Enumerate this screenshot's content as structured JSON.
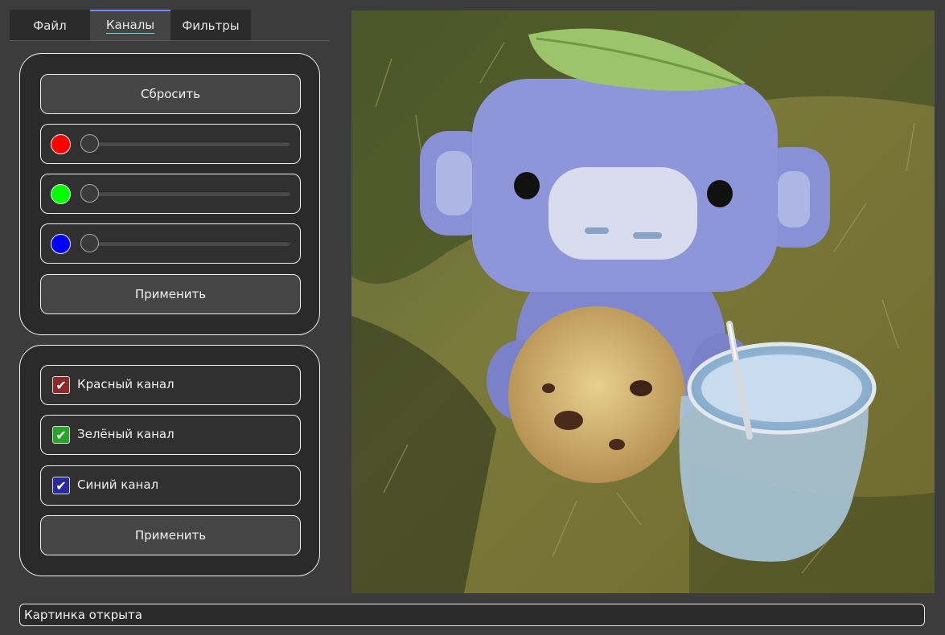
{
  "tabs": [
    {
      "label": "Файл"
    },
    {
      "label": "Каналы"
    },
    {
      "label": "Фильтры"
    }
  ],
  "active_tab": "Каналы",
  "channels_panel": {
    "reset_label": "Сбросить",
    "sliders": [
      {
        "channel": "red",
        "color": "#ff0000",
        "value": 0
      },
      {
        "channel": "green",
        "color": "#00ff00",
        "value": 0
      },
      {
        "channel": "blue",
        "color": "#0000ff",
        "value": 0
      }
    ],
    "apply_label": "Применить"
  },
  "toggle_panel": {
    "checkboxes": [
      {
        "label": "Красный канал",
        "checked": true,
        "color": "#8b2a2a"
      },
      {
        "label": "Зелёный канал",
        "checked": true,
        "color": "#2aa32a"
      },
      {
        "label": "Синий канал",
        "checked": true,
        "color": "#2a2a9a"
      }
    ],
    "apply_label": "Применить"
  },
  "status_text": "Картинка открыта",
  "colors": {
    "accent": "#7a86ff",
    "background": "#3c3c3c",
    "panel": "#2a2a2a"
  }
}
